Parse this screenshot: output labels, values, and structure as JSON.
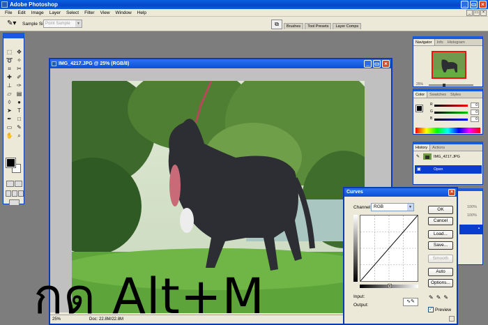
{
  "app": {
    "title": "Adobe Photoshop"
  },
  "menu": [
    "File",
    "Edit",
    "Image",
    "Layer",
    "Select",
    "Filter",
    "View",
    "Window",
    "Help"
  ],
  "options_bar": {
    "sample_size_label": "Sample Size:",
    "sample_size_value": "Point Sample",
    "palette_tabs": [
      "Brushes",
      "Tool Presets",
      "Layer Comps"
    ]
  },
  "document": {
    "title": "IMG_4217.JPG @ 25% (RGB/8)",
    "zoom": "25%",
    "doc_size": "Doc: 22.8M/22.8M"
  },
  "panels": {
    "navigator": {
      "tabs": [
        "Navigator",
        "Info",
        "Histogram"
      ],
      "zoom": "25%"
    },
    "color": {
      "tabs": [
        "Color",
        "Swatches",
        "Styles"
      ],
      "rows": [
        {
          "label": "R",
          "value": "0",
          "color": "#ff0000"
        },
        {
          "label": "G",
          "value": "0",
          "color": "#00c000"
        },
        {
          "label": "B",
          "value": "0",
          "color": "#0000ff"
        }
      ]
    },
    "history": {
      "tabs": [
        "History",
        "Actions"
      ],
      "items": [
        {
          "label": "IMG_4217.JPG",
          "selected": false
        },
        {
          "label": "Open",
          "selected": true
        }
      ]
    },
    "layers": {
      "values": [
        "100%",
        "100%"
      ]
    }
  },
  "curves": {
    "title": "Curves",
    "channel_label": "Channel:",
    "channel_value": "RGB",
    "buttons": {
      "ok": "OK",
      "cancel": "Cancel",
      "load": "Load...",
      "save": "Save...",
      "smooth": "Smooth",
      "auto": "Auto",
      "options": "Options..."
    },
    "input_label": "Input:",
    "output_label": "Output:",
    "preview_label": "Preview",
    "preview_checked": true
  },
  "overlay_text": "กด Alt+M",
  "colors": {
    "titlebar": "#0a50d8",
    "dialog_bg": "#ece9d8",
    "workspace": "#7d7d7d"
  }
}
